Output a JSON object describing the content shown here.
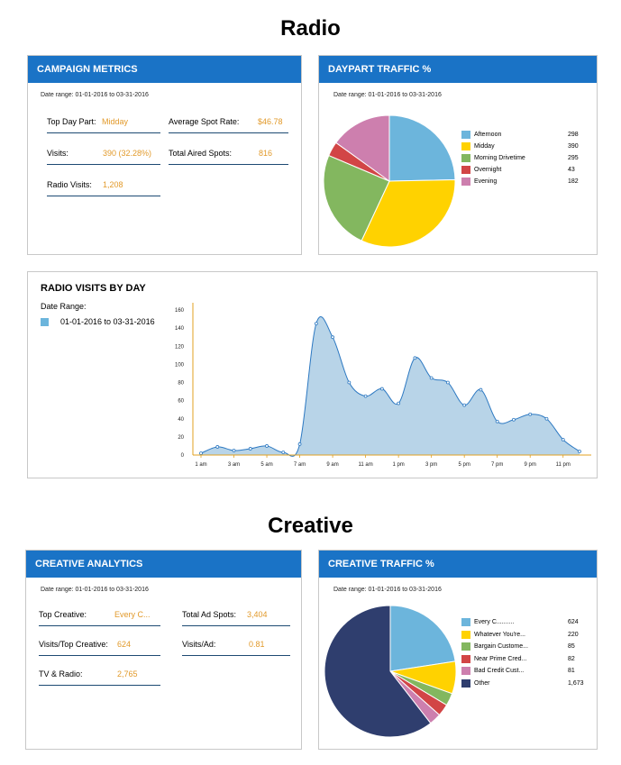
{
  "radio_title": "Radio",
  "creative_title": "Creative",
  "campaign": {
    "header": "CAMPAIGN METRICS",
    "date_range": "Date range: 01-01-2016 to 03-31-2016",
    "top_day_part_label": "Top Day Part:",
    "top_day_part_value": "Midday",
    "avg_spot_rate_label": "Average Spot Rate:",
    "avg_spot_rate_value": "$46.78",
    "visits_label": "Visits:",
    "visits_value": "390 (32.28%)",
    "total_aired_label": "Total Aired Spots:",
    "total_aired_value": "816",
    "radio_visits_label": "Radio Visits:",
    "radio_visits_value": "1,208"
  },
  "daypart": {
    "header": "DAYPART TRAFFIC %",
    "date_range": "Date range: 01-01-2016 to 03-31-2016"
  },
  "radio_visits": {
    "header": "RADIO VISITS BY DAY",
    "date_range_label": "Date Range:",
    "legend_label": "01-01-2016 to 03-31-2016"
  },
  "creative_analytics": {
    "header": "CREATIVE ANALYTICS",
    "date_range": "Date range: 01-01-2016 to 03-31-2016",
    "top_creative_label": "Top Creative:",
    "top_creative_value": "Every C...",
    "total_ad_spots_label": "Total Ad Spots:",
    "total_ad_spots_value": "3,404",
    "visits_top_creative_label": "Visits/Top Creative:",
    "visits_top_creative_value": "624",
    "visits_ad_label": "Visits/Ad:",
    "visits_ad_value": "0.81",
    "tv_radio_label": "TV & Radio:",
    "tv_radio_value": "2,765"
  },
  "creative_traffic": {
    "header": "CREATIVE TRAFFIC %",
    "date_range": "Date range: 01-01-2016 to 03-31-2016"
  },
  "chart_data": [
    {
      "type": "pie",
      "title": "DAYPART TRAFFIC %",
      "categories": [
        "Afternoon",
        "Midday",
        "Morning Drivetime",
        "Overnight",
        "Evening"
      ],
      "values": [
        298,
        390,
        295,
        43,
        182
      ],
      "colors": [
        "#6cb5dc",
        "#ffd200",
        "#83b75f",
        "#d24546",
        "#cd7fae"
      ],
      "legend": "right"
    },
    {
      "type": "area",
      "title": "RADIO VISITS BY DAY",
      "xlabel": "",
      "ylabel": "",
      "ylim": [
        0,
        160
      ],
      "yticks": [
        0,
        20,
        40,
        60,
        80,
        100,
        120,
        140,
        160
      ],
      "xtick_labels": [
        "1 am",
        "3 am",
        "5 am",
        "7 am",
        "9 am",
        "11 am",
        "1 pm",
        "3 pm",
        "5 pm",
        "7 pm",
        "9 pm",
        "11 pm"
      ],
      "series": [
        {
          "name": "01-01-2016 to 03-31-2016",
          "color": "#b8d4e8",
          "line_color": "#2d79c2",
          "x": [
            0,
            1,
            2,
            3,
            4,
            5,
            6,
            7,
            8,
            9,
            10,
            11,
            12,
            13,
            14,
            15,
            16,
            17,
            18,
            19,
            20,
            21,
            22,
            23
          ],
          "values": [
            2,
            9,
            5,
            7,
            10,
            3,
            12,
            145,
            130,
            80,
            65,
            73,
            57,
            107,
            85,
            80,
            55,
            72,
            37,
            39,
            45,
            40,
            17,
            4
          ]
        }
      ],
      "grid": false,
      "legend": "top-left"
    },
    {
      "type": "pie",
      "title": "CREATIVE TRAFFIC %",
      "categories": [
        "Every C..........",
        "Whatever You're...",
        "Bargain Custome...",
        "Near Prime Cred...",
        "Bad Credit Cust...",
        "Other"
      ],
      "values": [
        624,
        220,
        85,
        82,
        81,
        1673
      ],
      "colors": [
        "#6cb5dc",
        "#ffd200",
        "#83b75f",
        "#d24546",
        "#cd7fae",
        "#2f3e6e"
      ],
      "legend": "right"
    }
  ]
}
